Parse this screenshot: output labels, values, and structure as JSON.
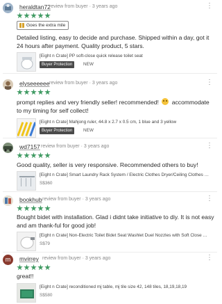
{
  "colors": {
    "star": "#3f9a62",
    "badge_bg": "#4a4a4a",
    "gift": "#d6a12b"
  },
  "reviews": [
    {
      "username": "heraldtan72",
      "meta": "review from buyer · 3 years ago",
      "rating": 5,
      "tag": "Goes the extra mile",
      "text": "Detailed listing, easy to decide and purchase. Shipped within a day, got it 24 hours after payment. Quality product, 5 stars.",
      "product": {
        "title": "[Eight n Crate] PP soft-close quick release toilet seat",
        "badge": "Buyer Protection",
        "condition": "NEW"
      }
    },
    {
      "username": "elyseeeeee",
      "meta": "review from buyer · 3 years ago",
      "rating": 5,
      "text_before": "prompt replies and very friendly seller! recommended!",
      "text_after": "accommodate to my timing for self collect!",
      "product": {
        "title": "[Eight n Crate] Mahjong ruler, 44.8 x 2.7 x 0.5 cm, 1 blue and 3 yellow",
        "badge": "Buyer Protection",
        "condition": "NEW"
      }
    },
    {
      "username": "wd7157",
      "meta": "review from buyer · 3 years ago",
      "rating": 5,
      "text": "Good quality, seller is very responsive. Recommended others to buy!",
      "product": {
        "title": "[Eight n Crate] Smart Laundry Rack System / Electric Clothes Dryer/Ceiling Clothes Hanger",
        "price": "S$360"
      }
    },
    {
      "username": "bookhub",
      "meta": "review from buyer · 3 years ago",
      "rating": 5,
      "text": "Bought bidet with installation. Glad i didnt take initiative to diy. It is not easy and am thank-ful for good job!",
      "product": {
        "title": "[Eight n Crate] Non-Electric Toilet Bidet Seat Washlet Duel Nozzles with Soft Close Cover",
        "price": "S$79"
      }
    },
    {
      "username": "mvirrey",
      "avatar_letter": "m",
      "meta": "review from buyer · 3 years ago",
      "rating": 5,
      "text": "great!!",
      "product": {
        "title": "[Eight n Crate] reconditioned mj table, mj tile size 42, 148 tiles, 18,19,18,19",
        "price": "S$580"
      }
    }
  ]
}
